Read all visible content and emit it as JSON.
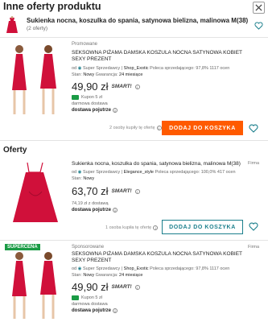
{
  "header": {
    "title": "Inne oferty produktu"
  },
  "product": {
    "name": "Sukienka nocna, koszulka do spania, satynowa bielizna, malinowa M(38)",
    "offers_count": "(2 oferty)"
  },
  "offers": [
    {
      "tag": "Promowane",
      "title": "SEKSOWNA PIŻAMA DAMSKA KOSZULA NOCNA SATYNOWA KOBIET SEXY PREZENT",
      "seller_prefix": "od",
      "seller_badge": "Super Sprzedawcy",
      "seller_name": "Shop_Exotic",
      "recommend": "Poleca sprzedającego: 97,8%",
      "reviews": "1117 ocen",
      "state_label": "Stan:",
      "state_value": "Nowy",
      "warranty_label": "Gwarancja:",
      "warranty_value": "24 miesiące",
      "price": "49,90 zł",
      "smart": "SMART!",
      "coupon": "Kupon 5 zł",
      "free_delivery": "darmowa dostawa",
      "shipping": "dostawa pojutrze",
      "bought": "2 osoby kupiły tę ofertę",
      "button": "DODAJ DO KOSZYKA"
    },
    {
      "firma": "Firma",
      "title": "Sukienka nocna, koszulka do spania, satynowa bielizna, malinowa M(38)",
      "seller_prefix": "od",
      "seller_badge": "Super Sprzedawcy",
      "seller_name": "Elegance_style",
      "recommend": "Poleca sprzedającego: 100,0%",
      "reviews": "417 ocen",
      "state_label": "Stan:",
      "state_value": "Nowy",
      "price": "63,70 zł",
      "smart": "SMART!",
      "delivery_price": "74,19 zł z dostawą",
      "shipping": "dostawa pojutrze",
      "bought": "1 osoba kupiła tę ofertę",
      "button": "DODAJ DO KOSZYKA"
    },
    {
      "badge": "SUPERCENA",
      "tag": "Sponsorowane",
      "firma": "Firma",
      "title": "SEKSOWNA PIŻAMA DAMSKA KOSZULA NOCNA SATYNOWA KOBIET SEXY PREZENT",
      "seller_prefix": "od",
      "seller_badge": "Super Sprzedawcy",
      "seller_name": "Shop_Exotic",
      "recommend": "Poleca sprzedającego: 97,8%",
      "reviews": "1117 ocen",
      "state_label": "Stan:",
      "state_value": "Nowy",
      "warranty_label": "Gwarancja:",
      "warranty_value": "24 miesiące",
      "price": "49,90 zł",
      "smart": "SMART!",
      "coupon": "Kupon 5 zł",
      "free_delivery": "darmowa dostawa",
      "shipping": "dostawa pojutrze"
    }
  ],
  "sections": {
    "offers_title": "Oferty"
  },
  "colors": {
    "accent_orange": "#ff5a00",
    "teal": "#1b7f8c",
    "green": "#1a9b45",
    "dress": "#d0103a"
  }
}
